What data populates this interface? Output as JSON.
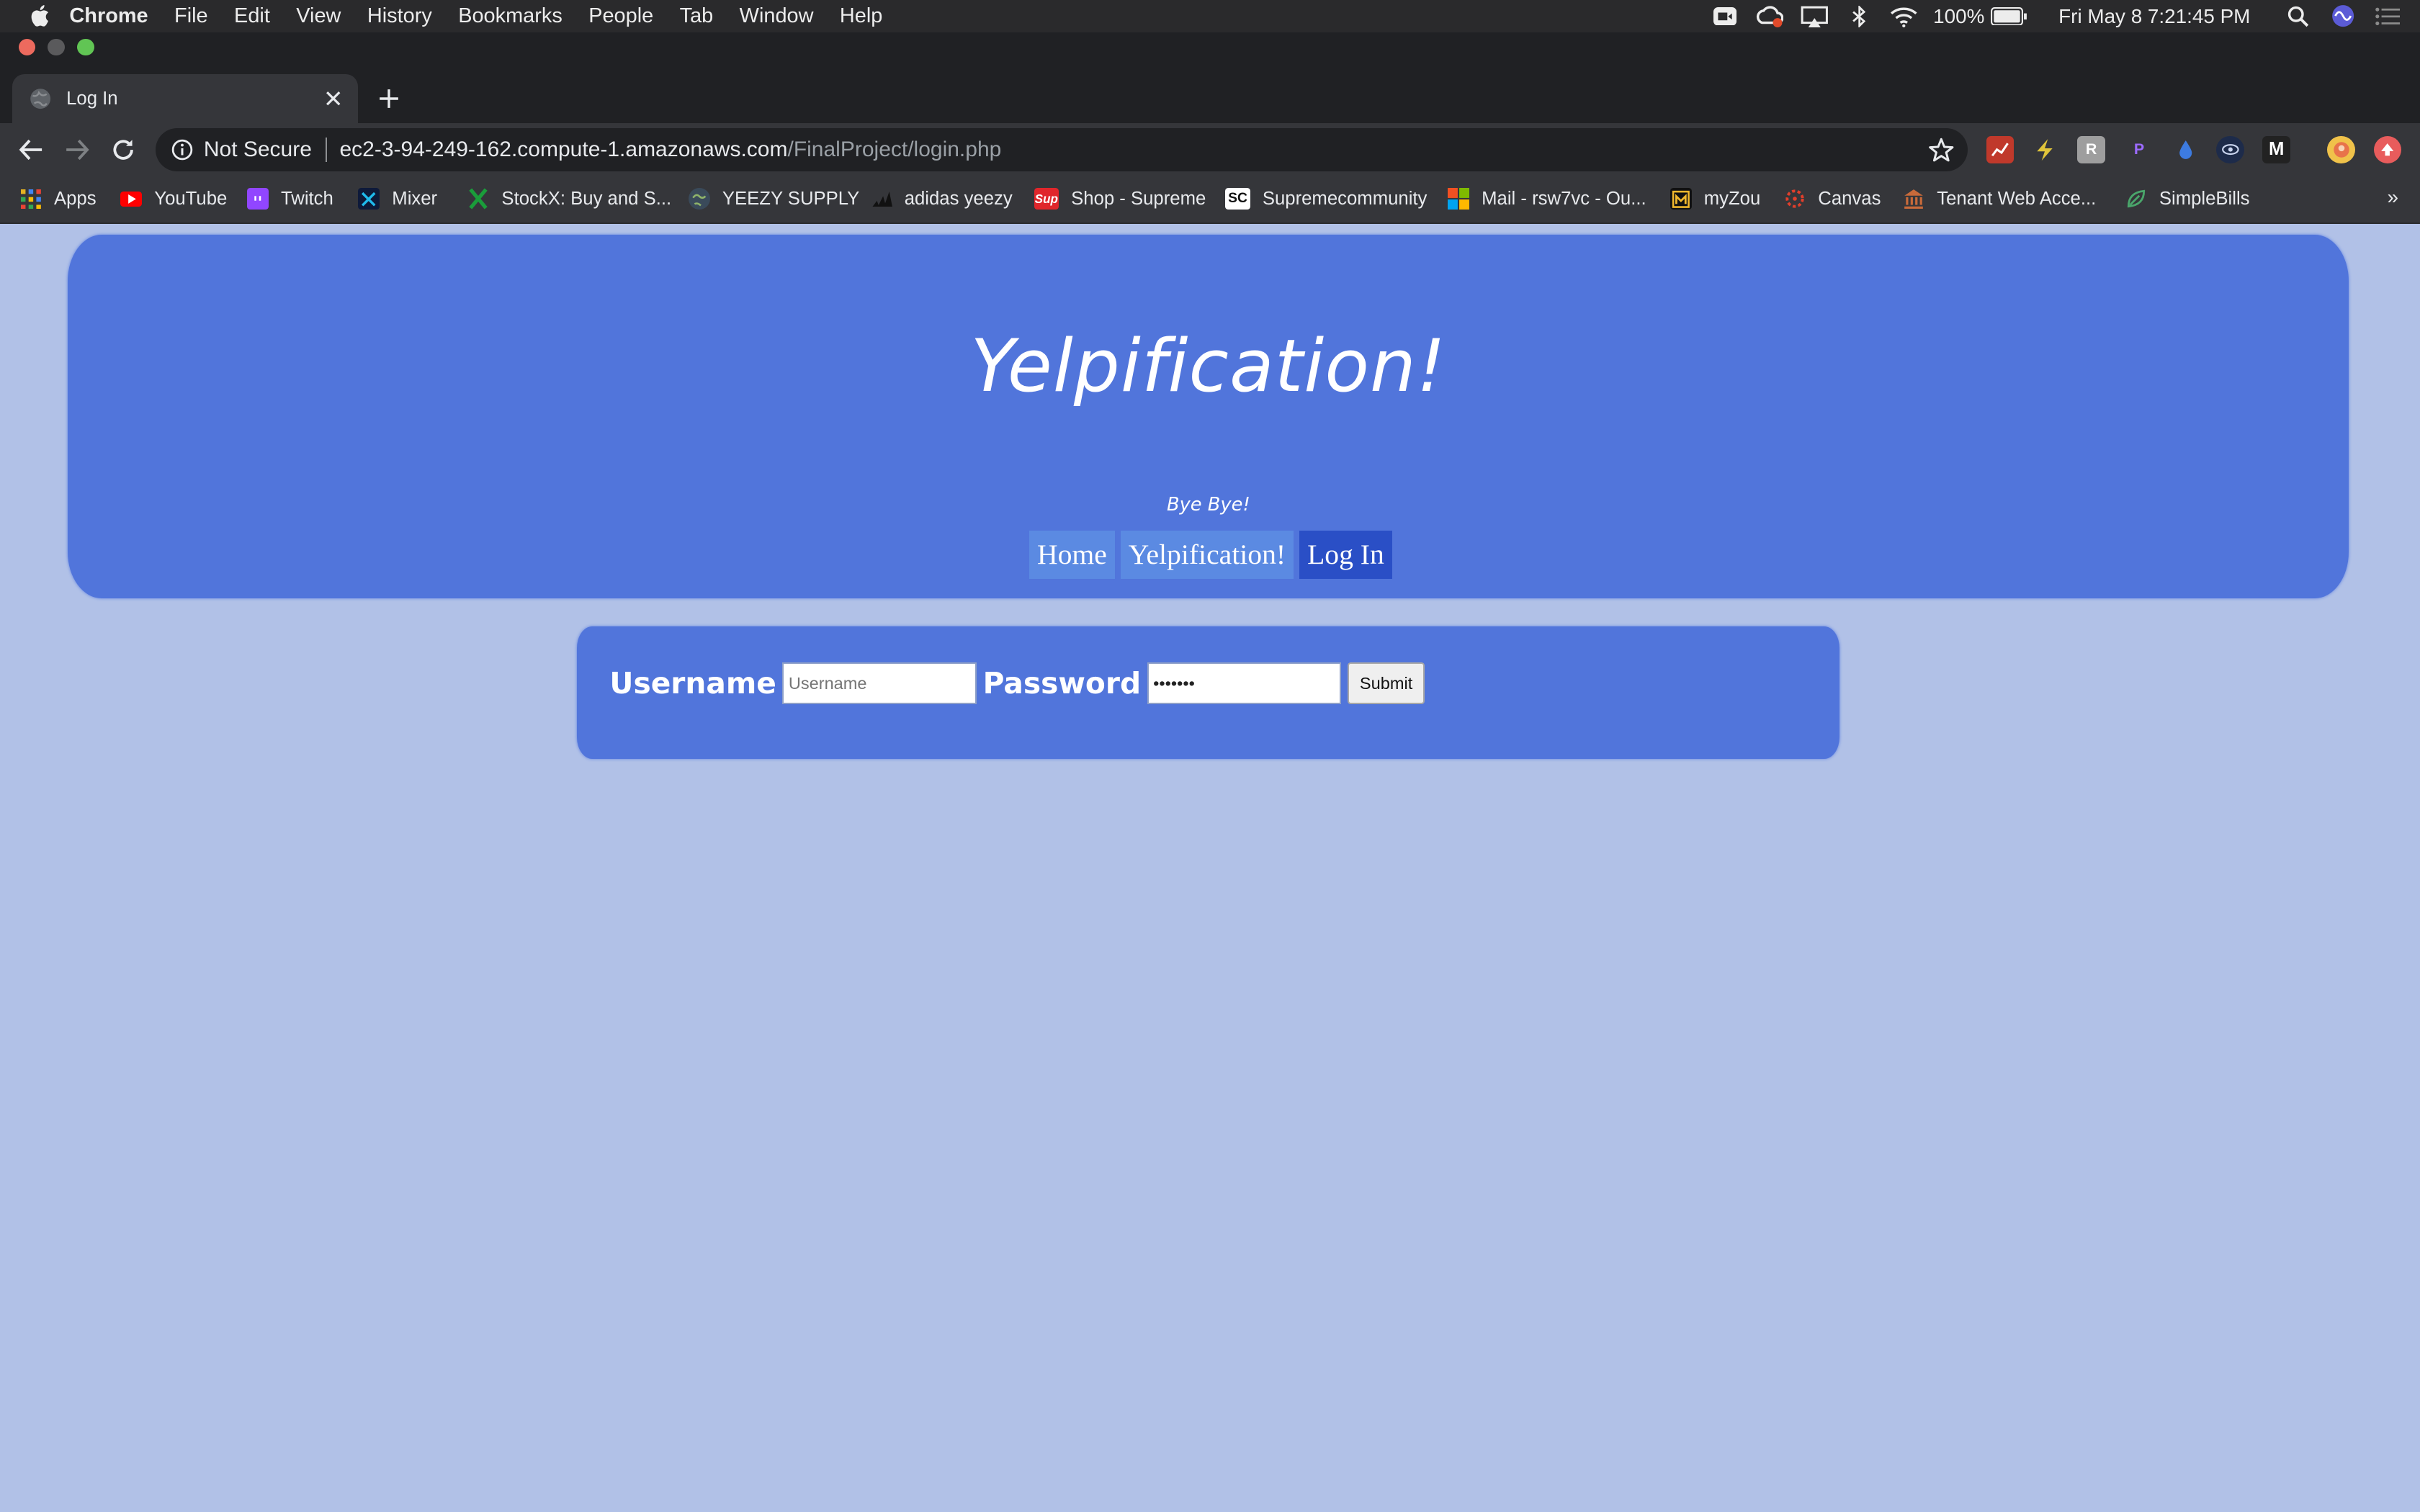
{
  "menubar": {
    "app_name": "Chrome",
    "items": [
      "File",
      "Edit",
      "View",
      "History",
      "Bookmarks",
      "People",
      "Tab",
      "Window",
      "Help"
    ],
    "battery": "100%",
    "datetime": "Fri May 8  7:21:45 PM",
    "status_icons": [
      "zoom-icon",
      "creative-cloud-icon",
      "airplay-icon",
      "bluetooth-icon",
      "wifi-icon",
      "battery-icon",
      "spotlight-search-icon",
      "siri-icon",
      "notification-center-icon"
    ]
  },
  "tab": {
    "title": "Log In"
  },
  "omnibox": {
    "security_label": "Not Secure",
    "url_host": "ec2-3-94-249-162.compute-1.amazonaws.com",
    "url_path": "/FinalProject/login.php"
  },
  "bookmarks": [
    {
      "label": "Apps",
      "icon": "apps-grid-icon",
      "color": "#e6b323"
    },
    {
      "label": "YouTube",
      "icon": "youtube-icon",
      "color": "#ff0000"
    },
    {
      "label": "Twitch",
      "icon": "twitch-icon",
      "color": "#9146ff"
    },
    {
      "label": "Mixer",
      "icon": "mixer-icon",
      "color": "#1fbaed"
    },
    {
      "label": "StockX: Buy and S...",
      "icon": "stockx-icon",
      "color": "#1a9d3a"
    },
    {
      "label": "YEEZY SUPPLY",
      "icon": "globe-icon",
      "color": "#8a8a8a"
    },
    {
      "label": "adidas yeezy",
      "icon": "adidas-icon",
      "color": "#111111"
    },
    {
      "label": "Shop - Supreme",
      "icon": "supreme-icon",
      "color": "#e0262b"
    },
    {
      "label": "Supremecommunity",
      "icon": "supremecommunity-icon",
      "color": "#ffffff"
    },
    {
      "label": "Mail - rsw7vc - Ou...",
      "icon": "microsoft-icon",
      "color": "#f25022"
    },
    {
      "label": "myZou",
      "icon": "mizzou-icon",
      "color": "#f1b82d"
    },
    {
      "label": "Canvas",
      "icon": "canvas-icon",
      "color": "#e13f2b"
    },
    {
      "label": "Tenant Web Acce...",
      "icon": "bank-icon",
      "color": "#c86a3a"
    },
    {
      "label": "SimpleBills",
      "icon": "leaf-icon",
      "color": "#4aa66b"
    }
  ],
  "bookmarks_overflow": "»",
  "page": {
    "site_title": "Yelpification!",
    "tagline": "Bye Bye!",
    "nav": [
      {
        "label": "Home",
        "active": false
      },
      {
        "label": "Yelpification!",
        "active": false
      },
      {
        "label": "Log In",
        "active": true
      }
    ],
    "form": {
      "username_label": "Username",
      "username_placeholder": "Username",
      "password_label": "Password",
      "password_value": "•••••••",
      "submit_label": "Submit"
    }
  },
  "colors": {
    "page_bg": "#b1c1e7",
    "panel_bg": "#5175db",
    "nav_bg": "#5b8ae2",
    "nav_active_bg": "#2a4fc6"
  }
}
